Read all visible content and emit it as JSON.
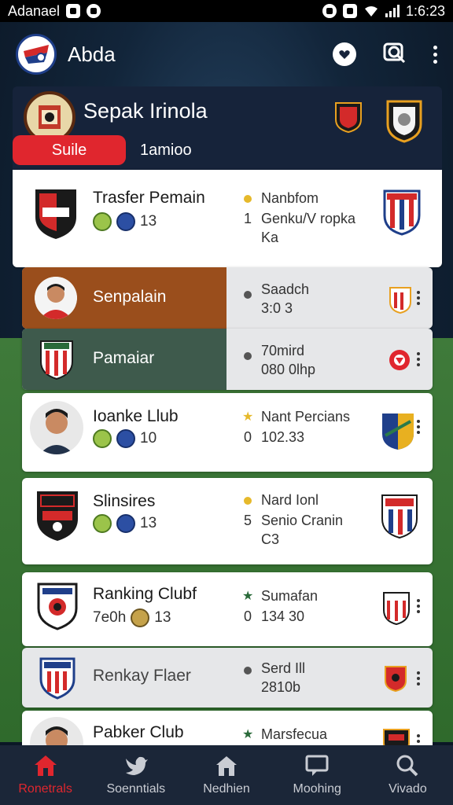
{
  "status_bar": {
    "carrier": "Adanael",
    "time": "1:6:23"
  },
  "app_bar": {
    "title": "Abda",
    "icons": [
      "heart-chat-icon",
      "search-icon",
      "more-icon"
    ]
  },
  "league": {
    "title": "Sepak Irinola",
    "tab_active": "Suile",
    "tab_inactive": "1amioo"
  },
  "rows": [
    {
      "name": "Trasfer Pemain",
      "badge_num": "13",
      "info1": "Nanbfom",
      "info2": "Genku/V ropka",
      "info3": "Ka",
      "info_prefix": "1"
    },
    {
      "name": "Senpalain",
      "info1": "Saadch",
      "info2": "3:0 3"
    },
    {
      "name": "Pamaiar",
      "info1": "70mird",
      "info2": "080 0lhp"
    },
    {
      "name": "Ioanke Llub",
      "badge_num": "10",
      "info1": "Nant Percians",
      "info2": "102.33",
      "info_prefix": "0"
    },
    {
      "name": "Slinsires",
      "badge_num": "13",
      "info1": "Nard Ionl",
      "info2": "Senio Cranin",
      "info3": "C3",
      "info_prefix": "5"
    },
    {
      "name": "Ranking Clubf",
      "left_meta": "7e0h",
      "badge_num": "13",
      "info1": "Sumafan",
      "info2": "134 30",
      "info_prefix": "0"
    },
    {
      "name": "Renkay Flaer",
      "info1": "Serd Ill",
      "info2": "2810b"
    },
    {
      "name": "Pabker Club",
      "info1": "Marsfecua"
    }
  ],
  "bottom_nav": [
    {
      "label": "Ronetrals",
      "icon": "home-icon"
    },
    {
      "label": "Soenntials",
      "icon": "bird-icon"
    },
    {
      "label": "Nedhien",
      "icon": "house-icon"
    },
    {
      "label": "Moohing",
      "icon": "chat-icon"
    },
    {
      "label": "Vivado",
      "icon": "search-icon"
    }
  ],
  "colors": {
    "accent": "#e0262e",
    "header": "#16233a",
    "nav": "#1b2638"
  }
}
